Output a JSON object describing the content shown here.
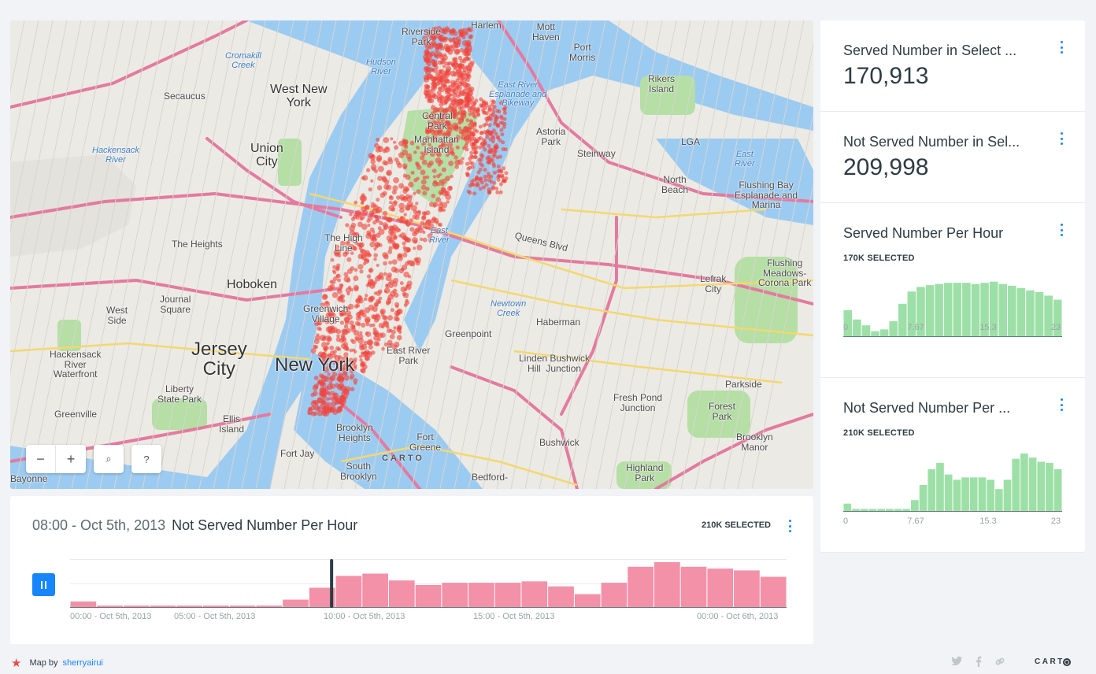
{
  "map": {
    "labels": [
      {
        "text": "West New\nYork",
        "cls": "mid"
      },
      {
        "text": "Secaucus",
        "cls": "small"
      },
      {
        "text": "Union\nCity",
        "cls": "mid"
      },
      {
        "text": "The Heights",
        "cls": "small"
      },
      {
        "text": "Hoboken",
        "cls": "mid"
      },
      {
        "text": "Journal\nSquare",
        "cls": "small"
      },
      {
        "text": "West\nSide",
        "cls": "small"
      },
      {
        "text": "Jersey\nCity",
        "cls": "big"
      },
      {
        "text": "Hackensack\nRiver\nWaterfront",
        "cls": "small"
      },
      {
        "text": "Liberty\nState Park",
        "cls": "small"
      },
      {
        "text": "Greenville",
        "cls": "small"
      },
      {
        "text": "Ellis\nIsland",
        "cls": "small"
      },
      {
        "text": "New York",
        "cls": "big"
      },
      {
        "text": "Harlem",
        "cls": "small"
      },
      {
        "text": "Mott\nHaven",
        "cls": "small"
      },
      {
        "text": "Port\nMorris",
        "cls": "small"
      },
      {
        "text": "Rikers\nIsland",
        "cls": "small"
      },
      {
        "text": "Astoria\nPark",
        "cls": "small"
      },
      {
        "text": "Steinway",
        "cls": "small"
      },
      {
        "text": "North\nBeach",
        "cls": "small"
      },
      {
        "text": "Flushing Bay\nEsplanade and\nMarina",
        "cls": "small"
      },
      {
        "text": "Flushing\nMeadows-\nCorona Park",
        "cls": "small"
      },
      {
        "text": "Lefrak\nCity",
        "cls": "small"
      },
      {
        "text": "Haberman",
        "cls": "small"
      },
      {
        "text": "Greenpoint",
        "cls": "small"
      },
      {
        "text": "Linden Bushwick\nHill  Junction",
        "cls": "small"
      },
      {
        "text": "Fresh Pond\nJunction",
        "cls": "small"
      },
      {
        "text": "Parkside",
        "cls": "small"
      },
      {
        "text": "Forest\nPark",
        "cls": "small"
      },
      {
        "text": "Brooklyn\nManor",
        "cls": "small"
      },
      {
        "text": "Bushwick",
        "cls": "small"
      },
      {
        "text": "Highland\nPark",
        "cls": "small"
      },
      {
        "text": "Brooklyn\nHeights",
        "cls": "small"
      },
      {
        "text": "Fort\nGreene",
        "cls": "small"
      },
      {
        "text": "Fort Jay",
        "cls": "small"
      },
      {
        "text": "South\nBrooklyn",
        "cls": "small"
      },
      {
        "text": "Bedford-",
        "cls": "small"
      },
      {
        "text": "Bayonne",
        "cls": "small"
      },
      {
        "text": "Hudson\nRiver",
        "cls": "water"
      },
      {
        "text": "Cromakill\nCreek",
        "cls": "water"
      },
      {
        "text": "Hackensack\nRiver",
        "cls": "water"
      },
      {
        "text": "East\nRiver",
        "cls": "water"
      },
      {
        "text": "Newtown\nCreek",
        "cls": "water"
      },
      {
        "text": "East\nRiver",
        "cls": "water"
      },
      {
        "text": "Queens Blvd",
        "cls": "small"
      },
      {
        "text": "LGA",
        "cls": "small"
      },
      {
        "text": "East River\nEsplanade and\nBikeway",
        "cls": "water"
      },
      {
        "text": "Central\nPark",
        "cls": "small"
      },
      {
        "text": "Manhattan\nIsland",
        "cls": "small"
      },
      {
        "text": "Riverside\nPark",
        "cls": "small"
      },
      {
        "text": "Greenwich\nVillage",
        "cls": "small"
      },
      {
        "text": "East River\nPark",
        "cls": "small"
      },
      {
        "text": "The High\nLine",
        "cls": "small"
      }
    ],
    "watermark": "CARTO",
    "controls": {
      "zoom_out": "−",
      "zoom_in": "+",
      "search_icon": "⌕",
      "help": "?"
    }
  },
  "widgets": [
    {
      "title": "Served Number in Select ...",
      "value": "170,913"
    },
    {
      "title": "Not Served Number in Sel...",
      "value": "209,998"
    },
    {
      "title": "Served Number Per Hour",
      "selected": "170K SELECTED",
      "ticks": [
        "0",
        "7.67",
        "15.3",
        "23"
      ],
      "bars": [
        0.46,
        0.3,
        0.2,
        0.1,
        0.13,
        0.27,
        0.57,
        0.78,
        0.86,
        0.89,
        0.91,
        0.93,
        0.93,
        0.93,
        0.91,
        0.93,
        0.95,
        0.91,
        0.88,
        0.84,
        0.8,
        0.77,
        0.71,
        0.64
      ]
    },
    {
      "title": "Not Served Number Per ...",
      "selected": "210K SELECTED",
      "ticks": [
        "0",
        "7.67",
        "15.3",
        "23"
      ],
      "bars": [
        0.14,
        0.05,
        0.05,
        0.05,
        0.05,
        0.05,
        0.05,
        0.05,
        0.2,
        0.46,
        0.73,
        0.84,
        0.64,
        0.55,
        0.59,
        0.59,
        0.59,
        0.55,
        0.39,
        0.55,
        0.91,
        1.0,
        0.93,
        0.86,
        0.84,
        0.73
      ]
    }
  ],
  "timeline": {
    "time": "08:00 - Oct 5th, 2013",
    "title": "Not Served Number Per Hour",
    "selected": "210K SELECTED",
    "ticks": [
      "00:00 - Oct 5th, 2013",
      "05:00 - Oct 5th, 2013",
      "10:00 - Oct 5th, 2013",
      "15:00 - Oct 5th, 2013",
      "00:00 - Oct 6th, 2013"
    ],
    "bars": [
      0.14,
      0.05,
      0.05,
      0.05,
      0.05,
      0.05,
      0.05,
      0.05,
      0.18,
      0.44,
      0.7,
      0.75,
      0.6,
      0.5,
      0.55,
      0.55,
      0.55,
      0.58,
      0.47,
      0.3,
      0.55,
      0.9,
      1.0,
      0.9,
      0.86,
      0.82,
      0.68
    ],
    "progress": 0.365
  },
  "footer": {
    "credit_prefix": "Map by",
    "author": "sherryairui",
    "brand": "CART"
  },
  "colors": {
    "accent": "#1785fb",
    "served_bar": "#9de0a7",
    "not_served_bar": "#f291a8",
    "map_points": "#f0443e"
  }
}
